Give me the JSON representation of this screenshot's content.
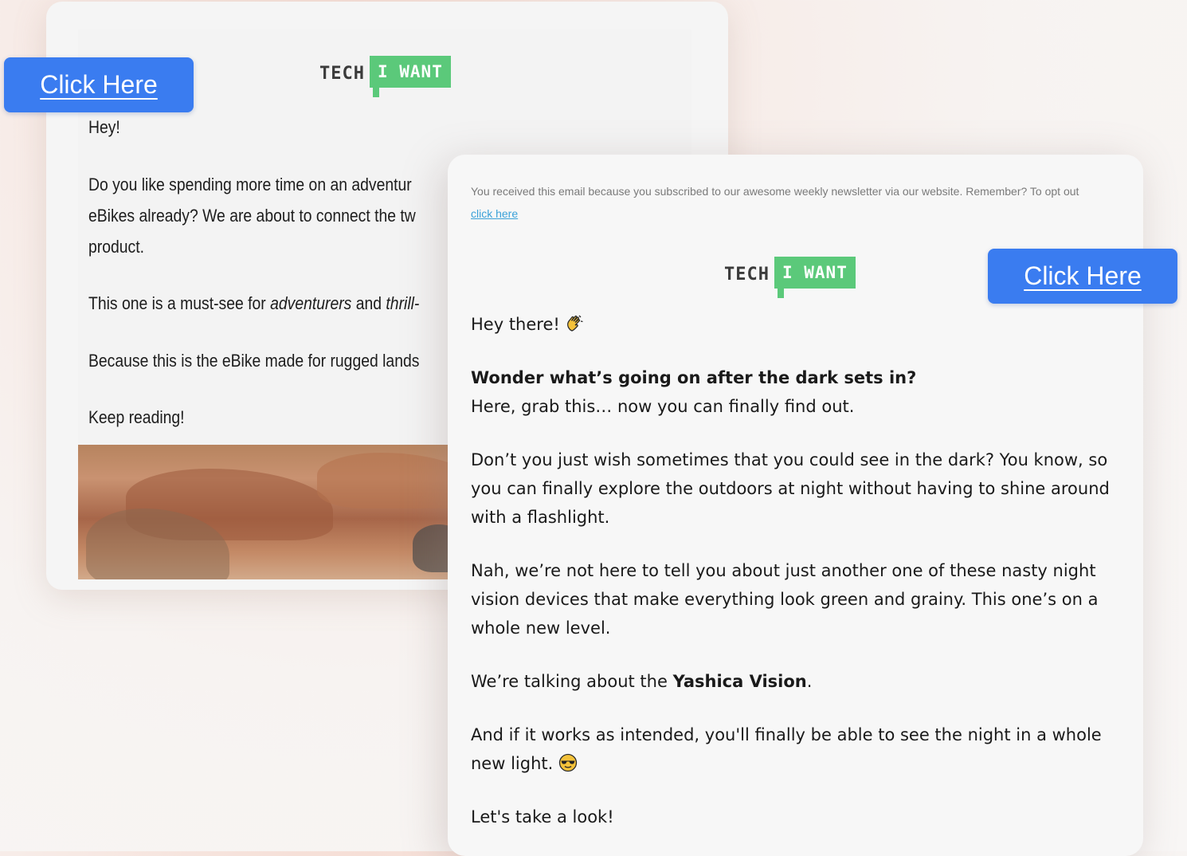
{
  "back_email": {
    "logo": {
      "tech": "TECH",
      "iwant": "I WANT"
    },
    "lines": [
      "Hey!",
      "Do you like spending more time on an adventur",
      "eBikes already? We are about to connect the tw",
      "product.",
      "This one is a must-see for adventurers and thrill-",
      "Because this is the eBike made for rugged lands",
      "Keep reading!"
    ],
    "italic_words": [
      "adventurers",
      "thrill-"
    ]
  },
  "front_email": {
    "notice": "You received this email because you subscribed to our awesome weekly newsletter via our website. Remember? To opt out",
    "notice_link": "click here",
    "logo": {
      "tech": "TECH",
      "iwant": "I WANT"
    },
    "greeting": "Hey there!",
    "headline": "Wonder what’s going on after the dark sets in?",
    "subline": "Here, grab this… now you can finally find out.",
    "para1": "Don’t you just wish sometimes that you could see in the dark? You know, so you can finally explore the outdoors at night without having to shine around with a flashlight.",
    "para2": "Nah, we’re not here to tell you about just another one of these nasty night vision devices that make everything look green and grainy. This one’s on a whole new level.",
    "para3_prefix": "We’re talking about the ",
    "para3_bold": "Yashica Vision",
    "para3_suffix": ".",
    "para4": "And if it works as intended, you'll finally be able to see the night in a whole new light.",
    "para5": "Let's take a look!",
    "icons": [
      "waving-hand-icon",
      "sunglasses-face-icon"
    ]
  },
  "cta_buttons": [
    {
      "label": "Click Here"
    },
    {
      "label": "Click Here"
    }
  ],
  "colors": {
    "cta": "#3a7cf0",
    "brand_green": "#5bc97a",
    "link": "#3aa1d8"
  }
}
